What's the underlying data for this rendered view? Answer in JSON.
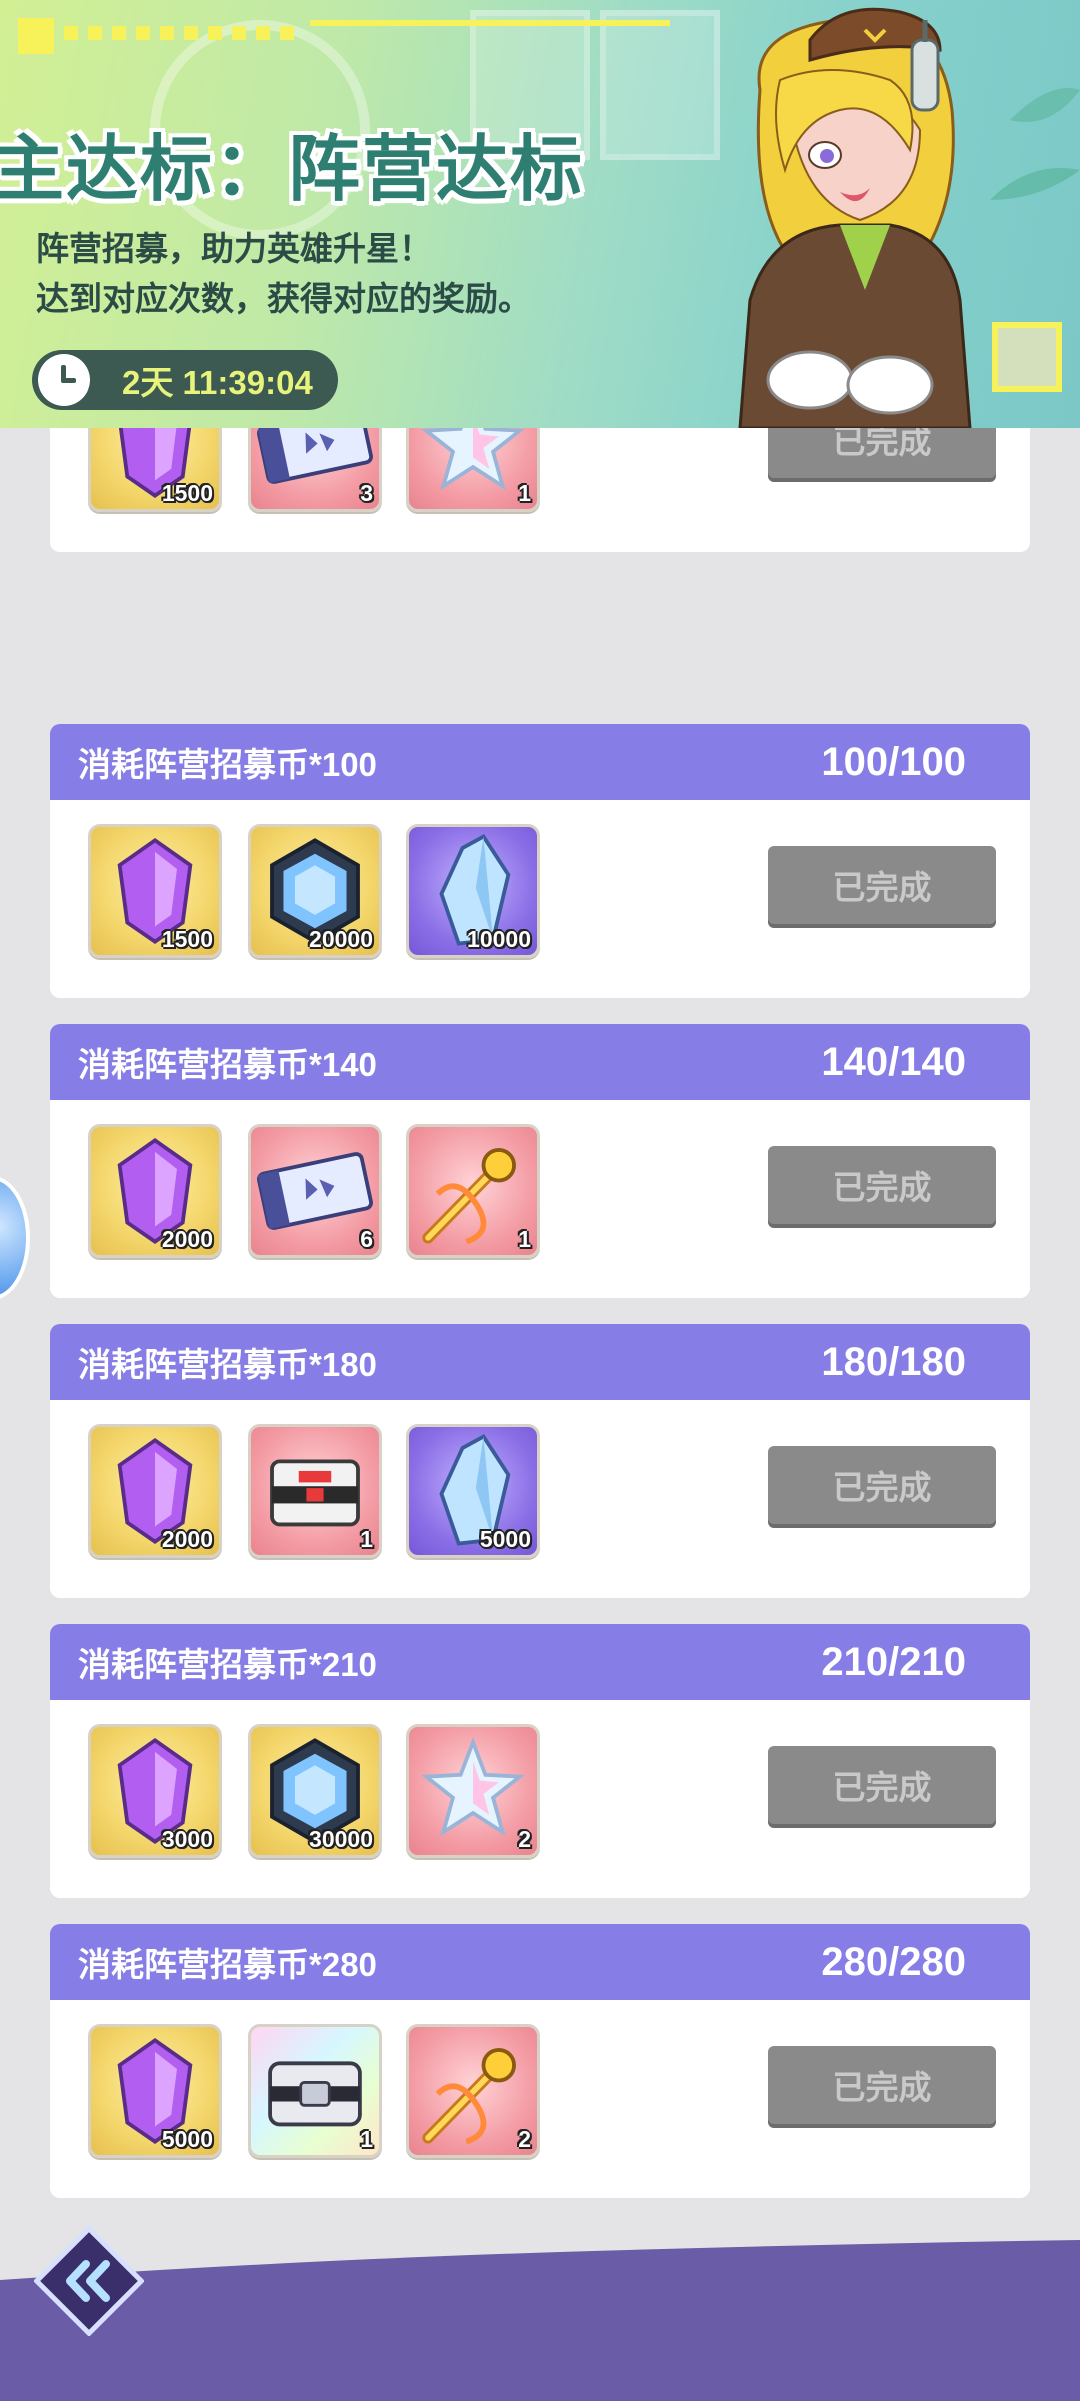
{
  "banner": {
    "title": "主达标：阵营达标",
    "desc_line1": "阵营招募，助力英雄升星！",
    "desc_line2": "达到对应次数，获得对应的奖励。",
    "countdown": "2天 11:39:04"
  },
  "colors": {
    "header_purple": "#877de6",
    "done_button": "#8a8a8a",
    "banner_title": "#2e7f72",
    "timer_text": "#e7f37a"
  },
  "tasks": [
    {
      "label": "",
      "progress": "",
      "rewards": [
        {
          "icon": "purple-gem-icon",
          "bg": "gold",
          "qty": "1500"
        },
        {
          "icon": "recruit-ticket-icon",
          "bg": "pink",
          "qty": "3"
        },
        {
          "icon": "star-shard-icon",
          "bg": "pink",
          "qty": "1"
        }
      ],
      "button": "已完成"
    },
    {
      "label": "消耗阵营招募币*100",
      "progress": "100/100",
      "rewards": [
        {
          "icon": "purple-gem-icon",
          "bg": "gold",
          "qty": "1500"
        },
        {
          "icon": "blue-hex-gem-icon",
          "bg": "gold",
          "qty": "20000"
        },
        {
          "icon": "blue-crystal-icon",
          "bg": "purple",
          "qty": "10000"
        }
      ],
      "button": "已完成"
    },
    {
      "label": "消耗阵营招募币*140",
      "progress": "140/140",
      "rewards": [
        {
          "icon": "purple-gem-icon",
          "bg": "gold",
          "qty": "2000"
        },
        {
          "icon": "recruit-ticket-icon",
          "bg": "pink",
          "qty": "6"
        },
        {
          "icon": "golden-sword-icon",
          "bg": "pink",
          "qty": "1"
        }
      ],
      "button": "已完成"
    },
    {
      "label": "消耗阵营招募币*180",
      "progress": "180/180",
      "rewards": [
        {
          "icon": "purple-gem-icon",
          "bg": "gold",
          "qty": "2000"
        },
        {
          "icon": "red-chest-icon",
          "bg": "pink",
          "qty": "1"
        },
        {
          "icon": "blue-crystal-icon",
          "bg": "purple",
          "qty": "5000"
        }
      ],
      "button": "已完成"
    },
    {
      "label": "消耗阵营招募币*210",
      "progress": "210/210",
      "rewards": [
        {
          "icon": "purple-gem-icon",
          "bg": "gold",
          "qty": "3000"
        },
        {
          "icon": "blue-hex-gem-icon",
          "bg": "gold",
          "qty": "30000"
        },
        {
          "icon": "star-shard-icon",
          "bg": "pink",
          "qty": "2"
        }
      ],
      "button": "已完成"
    },
    {
      "label": "消耗阵营招募币*280",
      "progress": "280/280",
      "rewards": [
        {
          "icon": "purple-gem-icon",
          "bg": "gold",
          "qty": "5000"
        },
        {
          "icon": "silver-chest-icon",
          "bg": "rainbow",
          "qty": "1"
        },
        {
          "icon": "golden-sword-icon",
          "bg": "pink",
          "qty": "2"
        }
      ],
      "button": "已完成"
    }
  ]
}
